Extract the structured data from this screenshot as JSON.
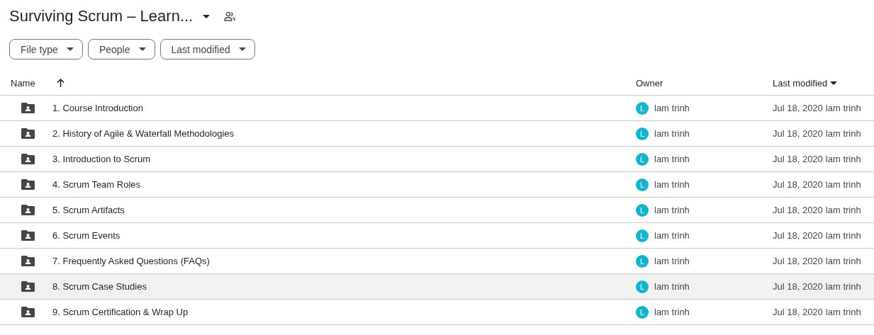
{
  "title": "Surviving Scrum – Learn...",
  "filters": [
    "File type",
    "People",
    "Last modified"
  ],
  "columns": {
    "name": "Name",
    "owner": "Owner",
    "modified": "Last modified"
  },
  "rows": [
    {
      "name": "1. Course Introduction",
      "avatar": "L",
      "owner": "lam trinh",
      "date": "Jul 18, 2020",
      "modified_by": "lam trinh",
      "hovered": false
    },
    {
      "name": "2. History of Agile & Waterfall Methodologies",
      "avatar": "L",
      "owner": "lam trinh",
      "date": "Jul 18, 2020",
      "modified_by": "lam trinh",
      "hovered": false
    },
    {
      "name": "3. Introduction to Scrum",
      "avatar": "L",
      "owner": "lam trinh",
      "date": "Jul 18, 2020",
      "modified_by": "lam trinh",
      "hovered": false
    },
    {
      "name": "4. Scrum Team Roles",
      "avatar": "L",
      "owner": "lam trinh",
      "date": "Jul 18, 2020",
      "modified_by": "lam trinh",
      "hovered": false
    },
    {
      "name": "5. Scrum Artifacts",
      "avatar": "L",
      "owner": "lam trinh",
      "date": "Jul 18, 2020",
      "modified_by": "lam trinh",
      "hovered": false
    },
    {
      "name": "6. Scrum Events",
      "avatar": "L",
      "owner": "lam trinh",
      "date": "Jul 18, 2020",
      "modified_by": "lam trinh",
      "hovered": false
    },
    {
      "name": "7. Frequently Asked Questions (FAQs)",
      "avatar": "L",
      "owner": "lam trinh",
      "date": "Jul 18, 2020",
      "modified_by": "lam trinh",
      "hovered": false
    },
    {
      "name": "8. Scrum Case Studies",
      "avatar": "L",
      "owner": "lam trinh",
      "date": "Jul 18, 2020",
      "modified_by": "lam trinh",
      "hovered": true
    },
    {
      "name": "9. Scrum Certification & Wrap Up",
      "avatar": "L",
      "owner": "lam trinh",
      "date": "Jul 18, 2020",
      "modified_by": "lam trinh",
      "hovered": false
    }
  ]
}
